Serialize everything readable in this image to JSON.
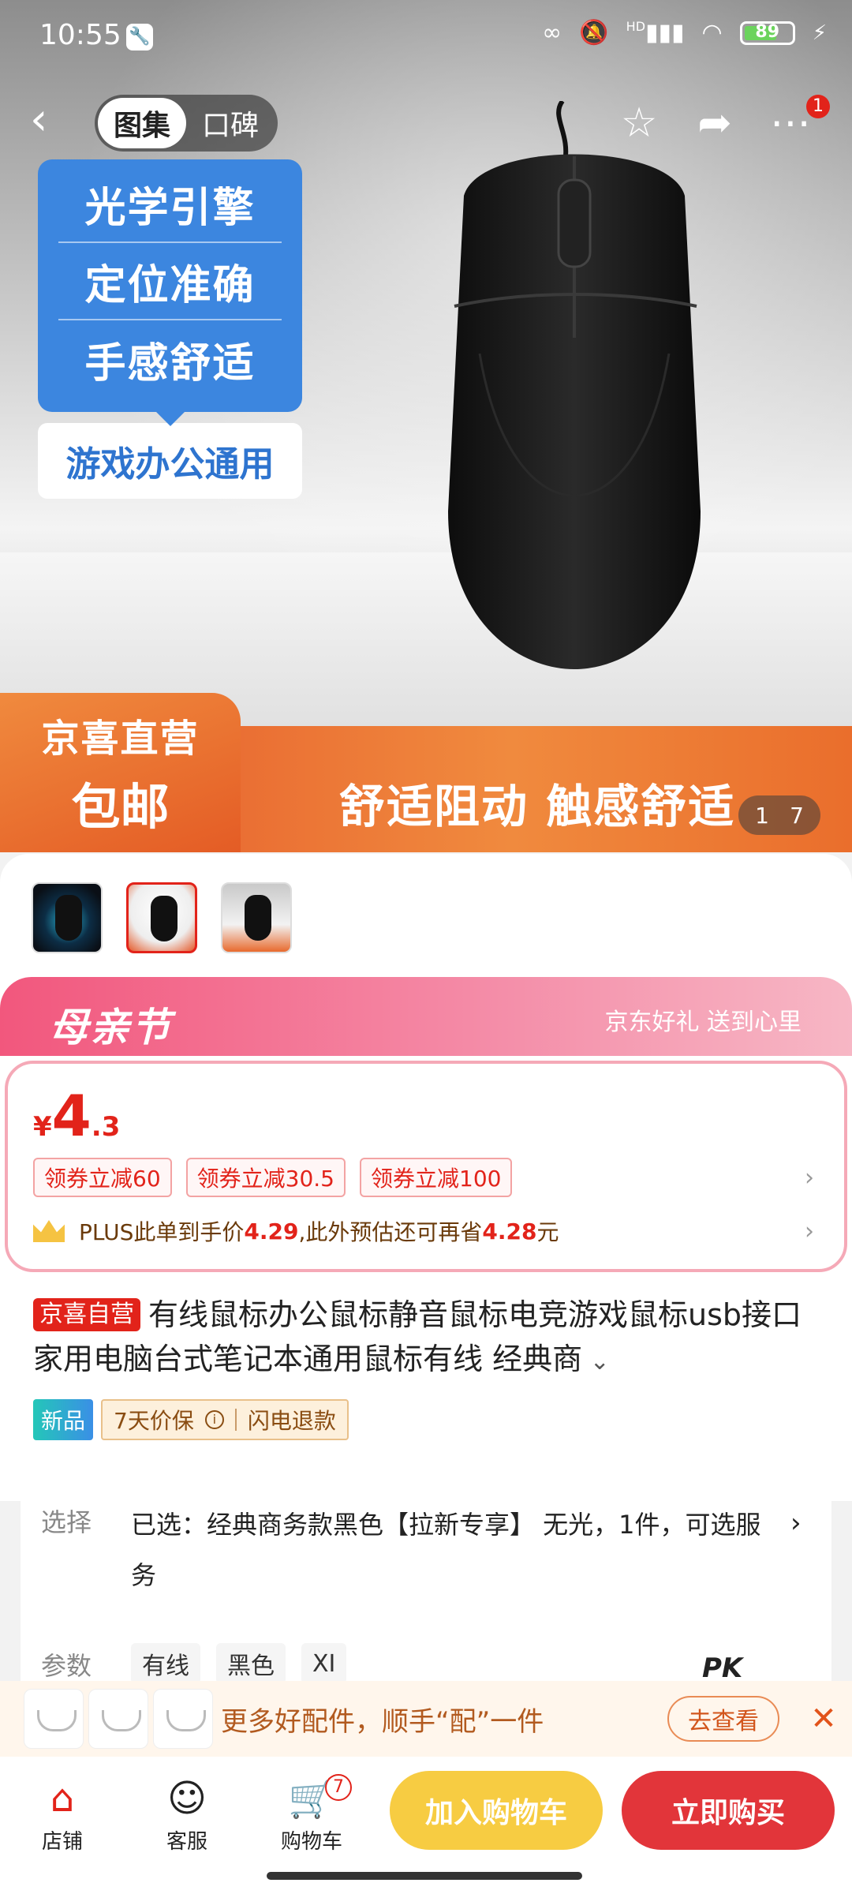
{
  "status_bar": {
    "time": "10:55",
    "battery": "89",
    "network": "HD"
  },
  "nav": {
    "tabs": [
      "图集",
      "口碑"
    ],
    "active_tab": 0,
    "more_badge": "1"
  },
  "hero": {
    "features": [
      "光学引擎",
      "定位准确",
      "手感舒适"
    ],
    "feature_footer": "游戏办公通用",
    "badge_line1": "京喜直营",
    "badge_line2": "包邮",
    "slogan": "舒适阻动 触感舒适",
    "counter_current": "1",
    "counter_total": "7"
  },
  "promo": {
    "title": "母亲节",
    "subtitle": "京东好礼 送到心里"
  },
  "price": {
    "currency": "¥",
    "integer": "4",
    "decimal": ".3"
  },
  "coupons": [
    "领券立减60",
    "领券立减30.5",
    "领券立减100"
  ],
  "plus": {
    "prefix": "PLUS此单到手价",
    "price1": "4.29",
    "mid": ",此外预估还可再省",
    "price2": "4.28",
    "suffix": "元"
  },
  "product": {
    "self_tag": "京喜自营",
    "title": "有线鼠标办公鼠标静音鼠标电竞游戏鼠标usb接口家用电脑台式笔记本通用鼠标有线 经典商"
  },
  "tags": {
    "new": "新品",
    "guarantee": "7天价保",
    "refund": "闪电退款"
  },
  "selection": {
    "label": "选择",
    "text": "已选：经典商务款黑色【拉新专享】 无光，1件，可选服务"
  },
  "params": {
    "label": "参数",
    "values": [
      "有线",
      "黑色",
      "XI"
    ],
    "pk": "PK"
  },
  "accessory": {
    "text": "更多好配件，顺手“配”一件",
    "button": "去查看"
  },
  "bottom": {
    "shop": "店铺",
    "service": "客服",
    "cart": "购物车",
    "cart_badge": "7",
    "add_cart": "加入购物车",
    "buy_now": "立即购买"
  }
}
